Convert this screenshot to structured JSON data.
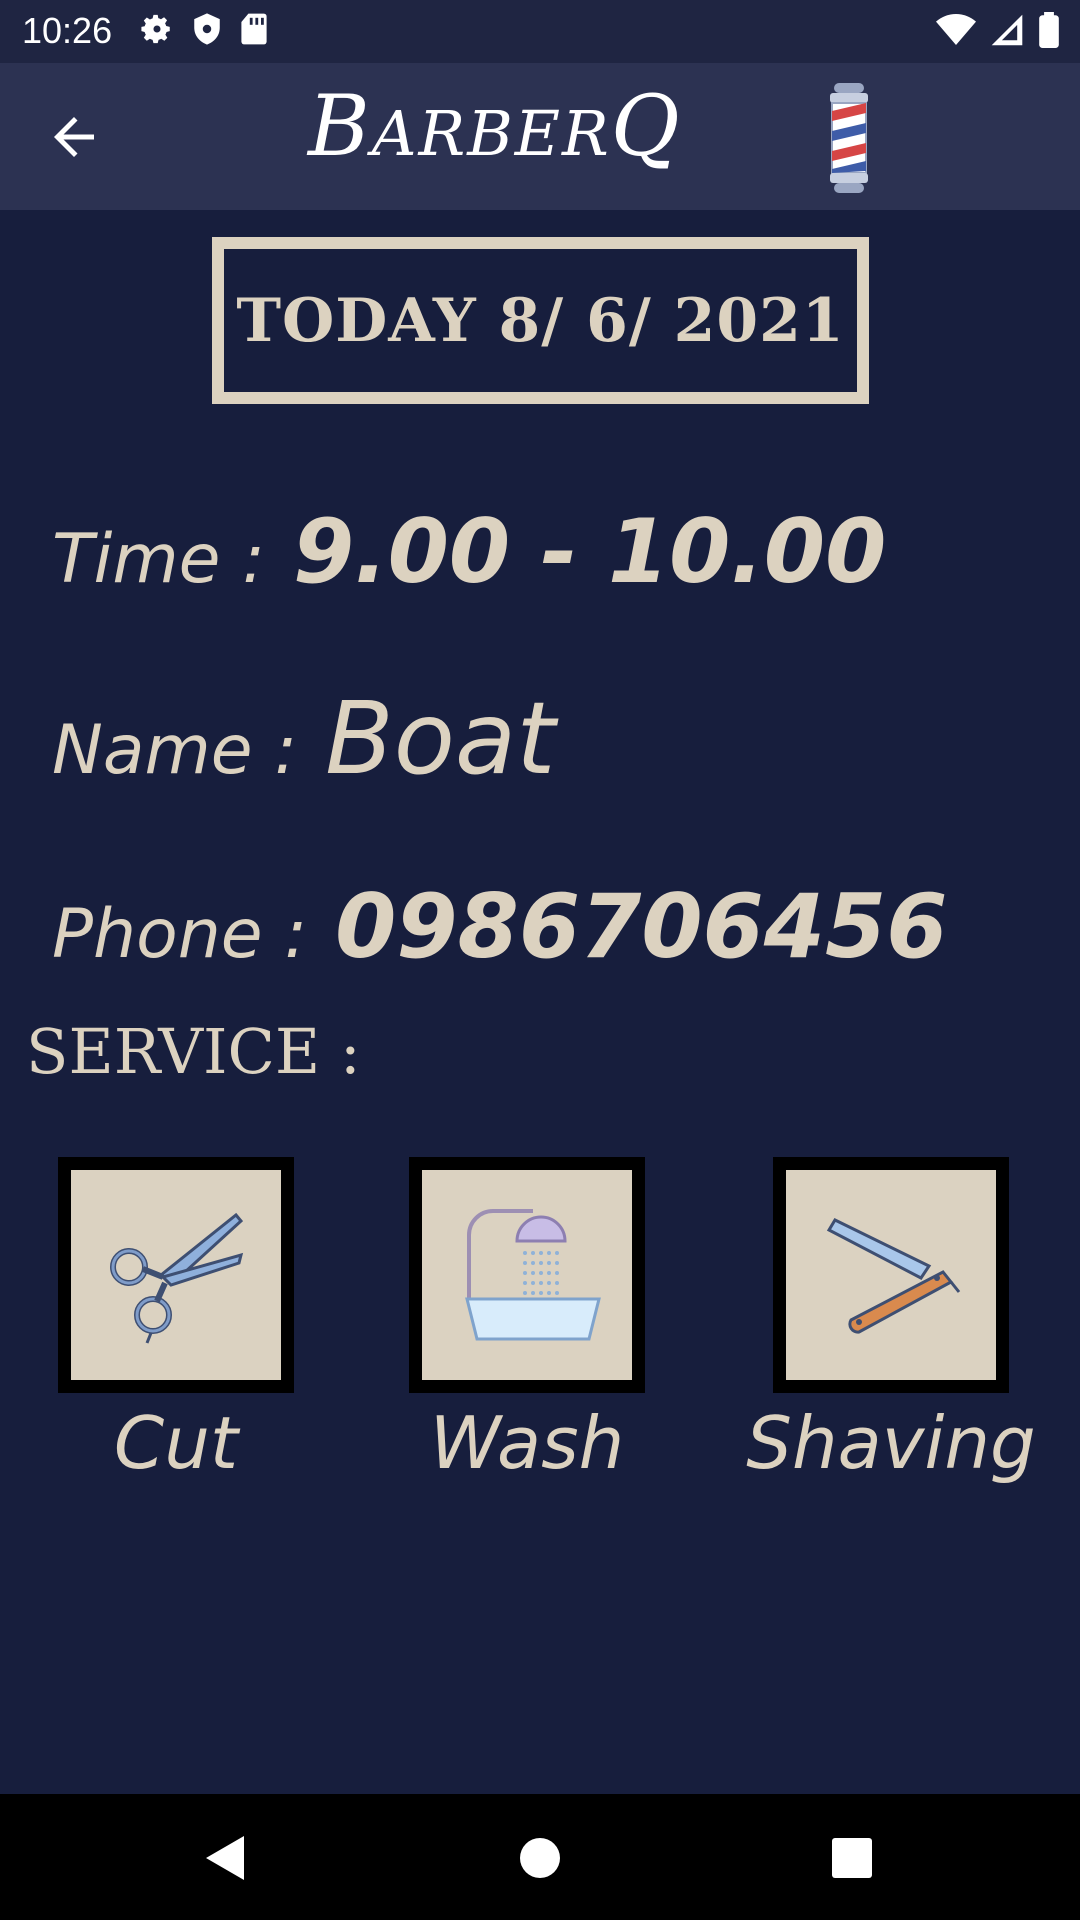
{
  "status_bar": {
    "time": "10:26"
  },
  "app_bar": {
    "brand_first": "B",
    "brand_rest": "ARBER",
    "brand_q": "Q"
  },
  "date": {
    "text": "TODAY 8/ 6/ 2021"
  },
  "details": {
    "time_label": "Time :",
    "time_value": "9.00 - 10.00",
    "name_label": "Name :",
    "name_value": "Boat",
    "phone_label": "Phone :",
    "phone_value": "0986706456"
  },
  "service_heading": "SERVICE :",
  "services": [
    {
      "label": "Cut",
      "icon": "scissors-icon"
    },
    {
      "label": "Wash",
      "icon": "hair-wash-icon"
    },
    {
      "label": "Shaving",
      "icon": "razor-icon"
    }
  ],
  "colors": {
    "background": "#171e3d",
    "app_bar": "#2c3252",
    "accent": "#dcd2c0"
  }
}
